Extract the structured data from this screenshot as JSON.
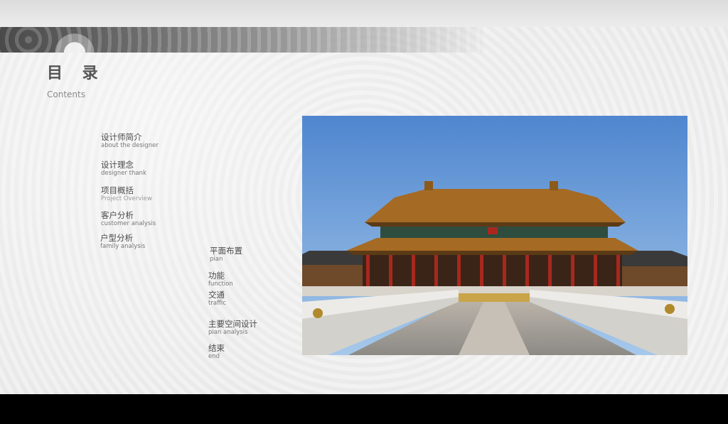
{
  "title": "目 录",
  "subtitle": "Contents",
  "toc_left": [
    {
      "zh": "设计师简介",
      "en": "about the designer"
    },
    {
      "zh": "设计理念",
      "en": "designer thank"
    },
    {
      "zh": "项目概括",
      "en": "Project Overview"
    },
    {
      "zh": "客户分析",
      "en": "customer analysis"
    },
    {
      "zh": "户型分析",
      "en": "family analysis"
    }
  ],
  "toc_right": [
    {
      "zh": "平面布置",
      "en": "pian"
    },
    {
      "zh": "功能",
      "en": "function"
    },
    {
      "zh": "交通",
      "en": "traffic"
    },
    {
      "zh": "主要空间设计",
      "en": "pian analysis"
    },
    {
      "zh": "结束",
      "en": "end"
    }
  ],
  "colors": {
    "sky_top": "#4f86cf",
    "sky_bottom": "#9cc3ea",
    "roof": "#b07a2e",
    "pillar": "#a8281e",
    "bottom_bar": "#000000"
  }
}
